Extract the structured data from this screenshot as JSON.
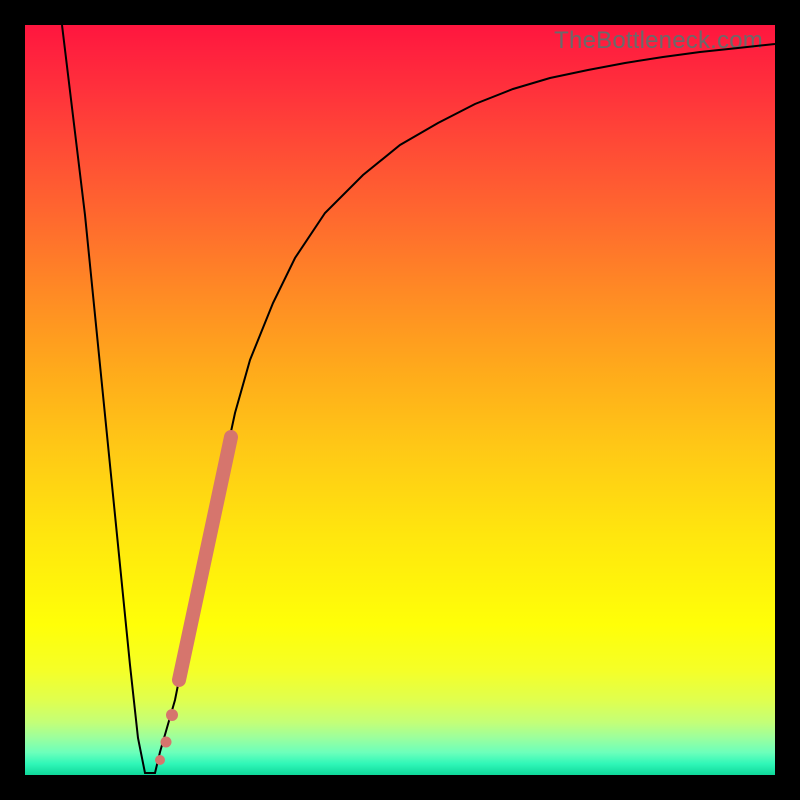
{
  "watermark": "TheBottleneck.com",
  "colors": {
    "curve": "#000000",
    "highlight": "#d6756d",
    "frame": "#000000"
  },
  "chart_data": {
    "type": "line",
    "title": "",
    "xlabel": "",
    "ylabel": "",
    "xlim": [
      0,
      100
    ],
    "ylim": [
      0,
      100
    ],
    "grid": false,
    "series": [
      {
        "name": "bottleneck-curve",
        "x": [
          5,
          8,
          10,
          12,
          14,
          15,
          16,
          17,
          18,
          20,
          22,
          25,
          28,
          30,
          33,
          36,
          40,
          45,
          50,
          55,
          60,
          65,
          70,
          75,
          80,
          85,
          90,
          95,
          100
        ],
        "y": [
          100,
          75,
          55,
          35,
          15,
          5,
          0,
          0,
          3,
          10,
          20,
          35,
          48,
          55,
          63,
          69,
          75,
          80,
          84,
          87,
          89.5,
          91.5,
          93,
          94,
          95,
          95.8,
          96.4,
          97,
          97.5
        ]
      }
    ],
    "highlight_segment": {
      "name": "recommended-range",
      "x": [
        20.5,
        27.5
      ],
      "y": [
        13,
        45
      ]
    },
    "highlight_points": [
      {
        "x": 18.0,
        "y": 2.0
      },
      {
        "x": 18.8,
        "y": 4.5
      },
      {
        "x": 19.6,
        "y": 8.0
      }
    ]
  }
}
